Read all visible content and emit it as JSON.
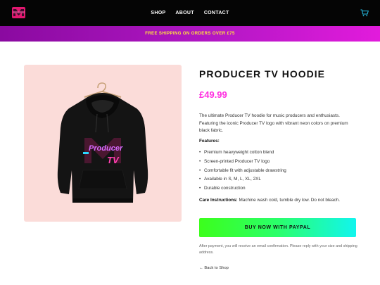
{
  "nav": {
    "logo_icon": "producer-tv-logo",
    "links": [
      "SHOP",
      "ABOUT",
      "CONTACT"
    ],
    "cart_icon": "cart-icon"
  },
  "promo": {
    "text": "FREE SHIPPING ON ORDERS OVER £75"
  },
  "product": {
    "title": "PRODUCER TV HOODIE",
    "price": "£49.99",
    "image_logo_text": "Producer",
    "image_logo_tv": "TV",
    "description": "The ultimate Producer TV hoodie for music producers and enthusiasts. Featuring the iconic Producer TV logo with vibrant neon colors on premium black fabric.",
    "features_label": "Features:",
    "features": [
      "Premium heavyweight cotton blend",
      "Screen-printed Producer TV logo",
      "Comfortable fit with adjustable drawstring",
      "Available in S, M, L, XL, 2XL",
      "Durable construction"
    ],
    "care_label": "Care Instructions:",
    "care_text": " Machine wash cold, tumble dry low. Do not bleach.",
    "buy_label": "BUY NOW WITH PAYPAL",
    "note": "After payment, you will receive an email confirmation. Please reply with your size and shipping address.",
    "back_label": "← Back to Shop"
  },
  "colors": {
    "accent_pink": "#ff2fe0",
    "promo_text": "#ffe63a",
    "button_green": "#3cff1c",
    "button_cyan": "#12f5ee"
  }
}
